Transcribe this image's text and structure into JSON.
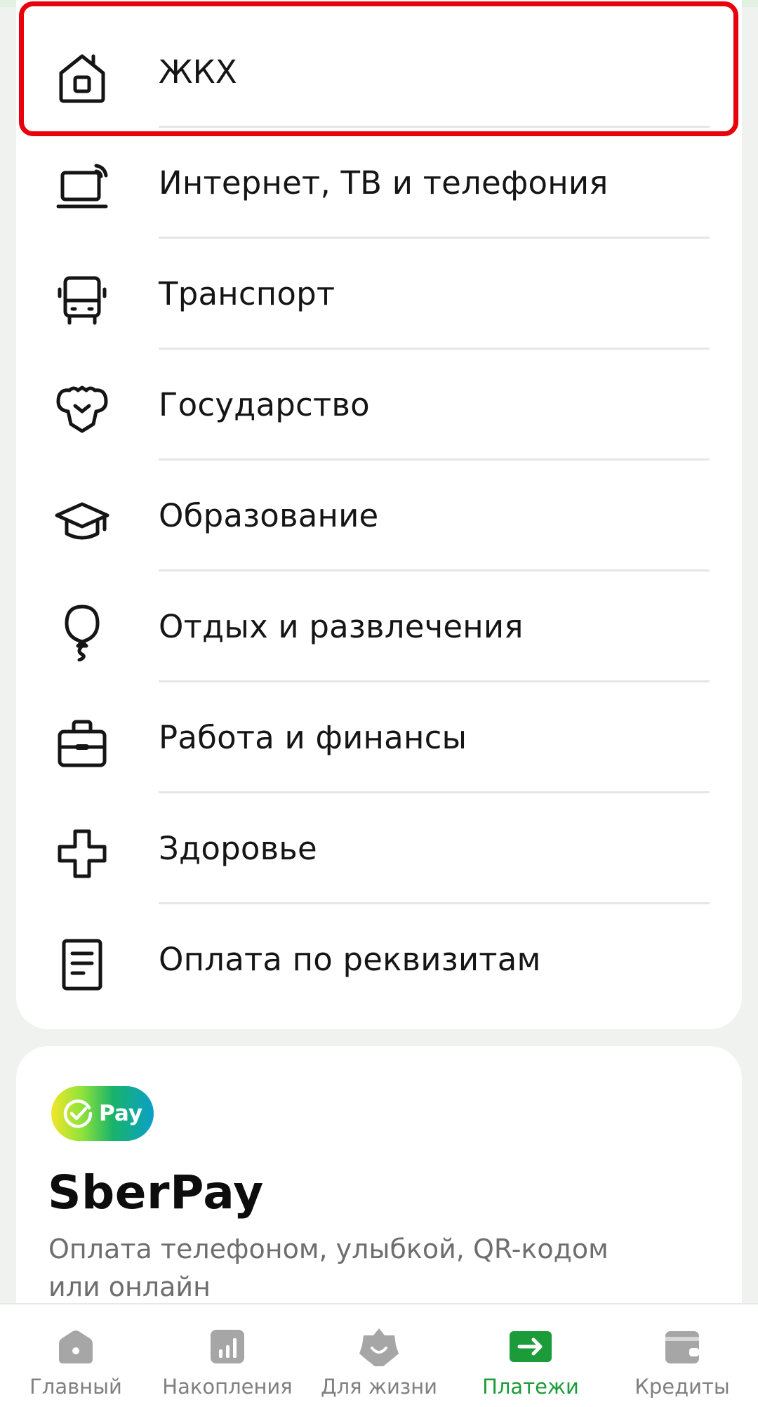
{
  "categories": [
    {
      "label": "ЖКХ",
      "icon": "house-icon"
    },
    {
      "label": "Интернет, ТВ и телефония",
      "icon": "laptop-signal-icon"
    },
    {
      "label": "Транспорт",
      "icon": "bus-icon"
    },
    {
      "label": "Государство",
      "icon": "government-emblem-icon"
    },
    {
      "label": "Образование",
      "icon": "graduation-cap-icon"
    },
    {
      "label": "Отдых и развлечения",
      "icon": "balloon-icon"
    },
    {
      "label": "Работа и финансы",
      "icon": "briefcase-icon"
    },
    {
      "label": "Здоровье",
      "icon": "medical-cross-icon"
    },
    {
      "label": "Оплата по реквизитам",
      "icon": "document-icon"
    }
  ],
  "sberpay": {
    "badge_label": "Pay",
    "title": "SberPay",
    "subtitle": "Оплата телефоном, улыбкой, QR-кодом или онлайн"
  },
  "bottom_nav": {
    "items": [
      {
        "label": "Главный",
        "icon": "home-icon"
      },
      {
        "label": "Накопления",
        "icon": "savings-chart-icon"
      },
      {
        "label": "Для жизни",
        "icon": "smile-star-icon"
      },
      {
        "label": "Платежи",
        "icon": "payments-arrow-icon"
      },
      {
        "label": "Кредиты",
        "icon": "wallet-icon"
      }
    ],
    "active_index": 3
  },
  "colors": {
    "accent": "#1b9b3a",
    "highlight": "#e8000c",
    "inactive_nav": "#a6a6a6"
  }
}
